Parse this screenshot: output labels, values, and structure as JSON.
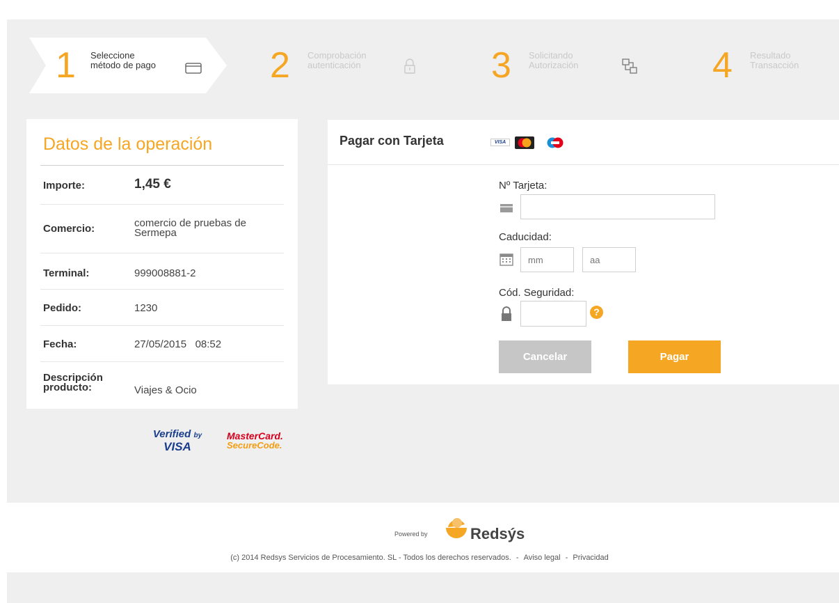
{
  "steps": [
    {
      "number": "1",
      "label_line1": "Seleccione",
      "label_line2": "método de pago",
      "active": true
    },
    {
      "number": "2",
      "label_line1": "Comprobación",
      "label_line2": "autenticación",
      "active": false
    },
    {
      "number": "3",
      "label_line1": "Solicitando",
      "label_line2": "Autorización",
      "active": false
    },
    {
      "number": "4",
      "label_line1": "Resultado",
      "label_line2": "Transacción",
      "active": false
    }
  ],
  "operation": {
    "title": "Datos de la operación",
    "amount_label": "Importe:",
    "amount_value": "1,45  €",
    "merchant_label": "Comercio:",
    "merchant_value_line1": "comercio de pruebas de",
    "merchant_value_line2": "Sermepa",
    "terminal_label": "Terminal:",
    "terminal_value": "999008881-2",
    "order_label": "Pedido:",
    "order_value": "1230",
    "date_label": "Fecha:",
    "date_value": "27/05/2015   08:52",
    "description_label_line1": "Descripción",
    "description_label_line2": "producto:",
    "description_value": "Viajes & Ocio"
  },
  "badges": {
    "verified_line1": "Verified",
    "verified_by": "by",
    "verified_line2": "VISA",
    "mastercard_line1": "MasterCard.",
    "mastercard_line2": "SecureCode."
  },
  "payment": {
    "title": "Pagar con Tarjeta",
    "card_number_label": "Nº Tarjeta:",
    "card_number_value": "",
    "expiry_label": "Caducidad:",
    "expiry_month_placeholder": "mm",
    "expiry_year_placeholder": "aa",
    "cvv_label": "Cód. Seguridad:",
    "cvv_value": "",
    "help_symbol": "?",
    "cancel_label": "Cancelar",
    "pay_label": "Pagar",
    "card_brands": [
      "VISA",
      "MasterCard",
      "Maestro"
    ]
  },
  "footer": {
    "powered_by": "Powered by",
    "brand": "Redsýs",
    "copyright": "(c) 2014 Redsys Servicios de Procesamiento. SL - Todos los derechos reservados.",
    "sep1": "-",
    "legal": "Aviso legal",
    "sep2": "-",
    "privacy": "Privacidad"
  },
  "colors": {
    "accent": "#f5a623",
    "background": "#efeff0",
    "cancel": "#c6c6c6"
  },
  "icons": [
    "credit-card-icon",
    "lock-icon",
    "authorization-icon",
    "calendar-icon",
    "padlock-icon",
    "help-icon"
  ]
}
